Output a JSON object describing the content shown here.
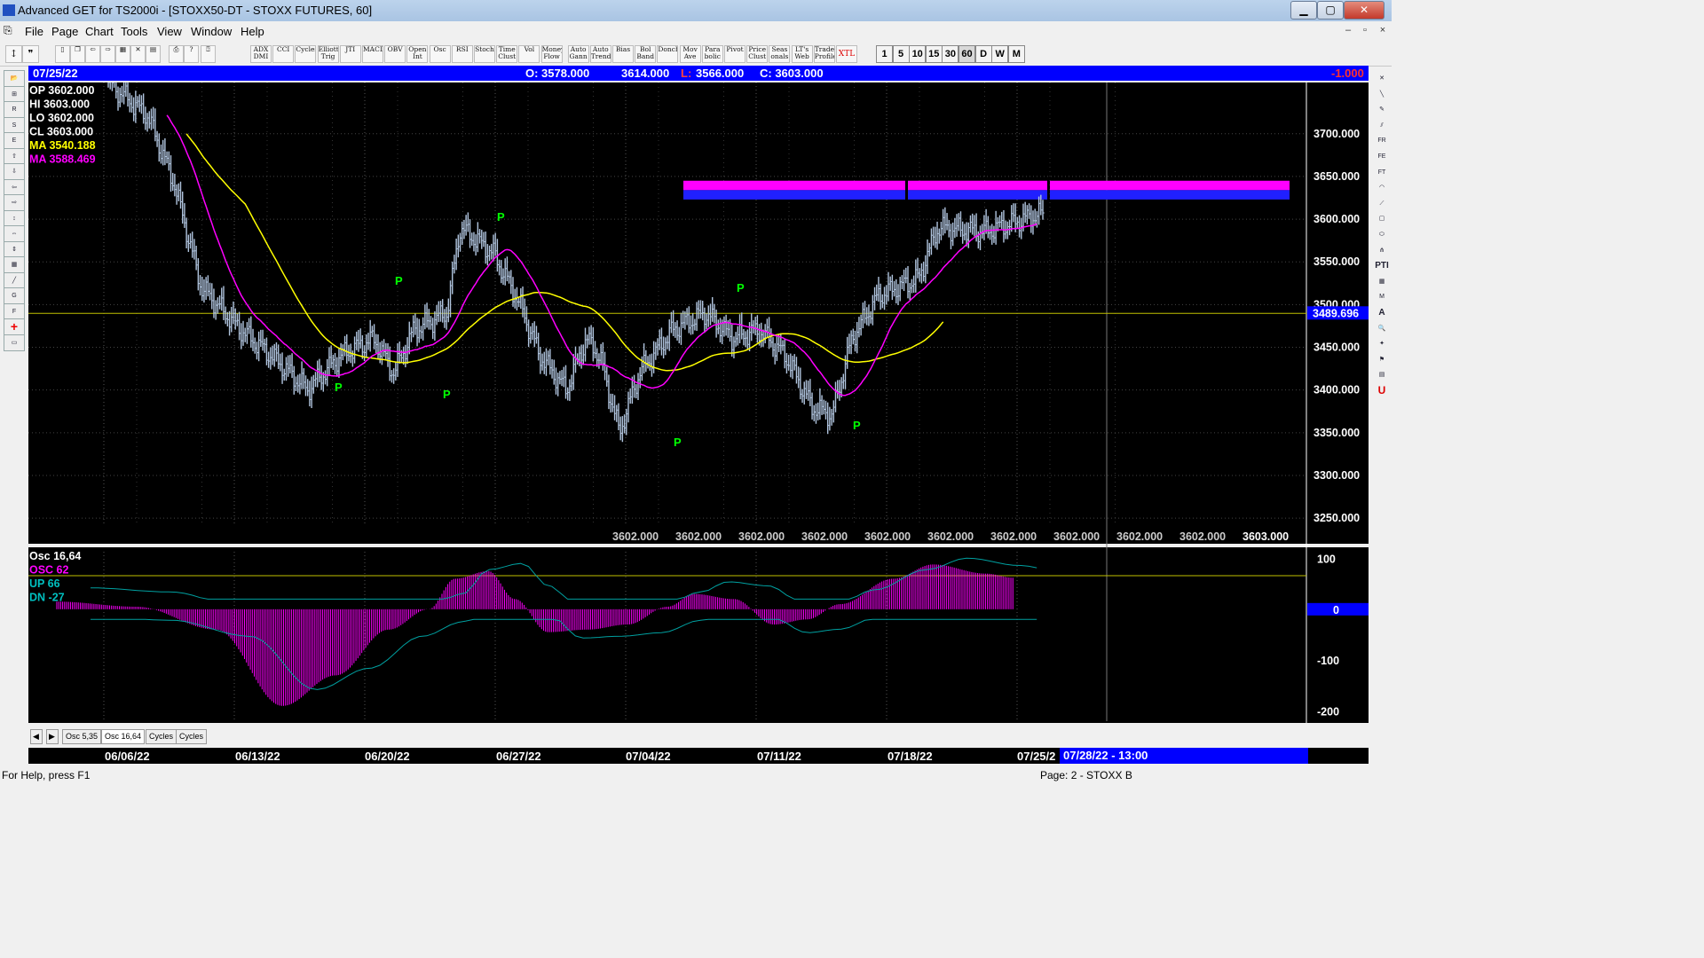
{
  "window": {
    "title": "Advanced GET for TS2000i - [STOXX50-DT - STOXX FUTURES, 60]",
    "min_label": "▁",
    "max_label": "▢",
    "close_label": "✕"
  },
  "menu": [
    "File",
    "Page",
    "Chart",
    "Tools",
    "View",
    "Window",
    "Help"
  ],
  "toolbar_studies": [
    {
      "id": "adx",
      "label": "ADX DMI"
    },
    {
      "id": "cci",
      "label": "CCI"
    },
    {
      "id": "cycles",
      "label": "Cycles"
    },
    {
      "id": "elliott",
      "label": "Elliott Trig"
    },
    {
      "id": "jti",
      "label": "JTI"
    },
    {
      "id": "macd",
      "label": "MACD"
    },
    {
      "id": "obv",
      "label": "OBV"
    },
    {
      "id": "openint",
      "label": "Open Int"
    },
    {
      "id": "osc",
      "label": "Osc"
    },
    {
      "id": "rsi",
      "label": "RSI"
    },
    {
      "id": "stoch",
      "label": "Stoch"
    },
    {
      "id": "timeclust",
      "label": "Time Clust"
    },
    {
      "id": "vol",
      "label": "Vol"
    },
    {
      "id": "moneyflow",
      "label": "Money Flow"
    },
    {
      "id": "autogann",
      "label": "Auto Gann"
    },
    {
      "id": "autotrend",
      "label": "Auto Trend"
    },
    {
      "id": "bias",
      "label": "Bias"
    },
    {
      "id": "bolband",
      "label": "Bol Band"
    },
    {
      "id": "donch",
      "label": "Donch"
    },
    {
      "id": "movave",
      "label": "Mov Ave"
    },
    {
      "id": "parabolic",
      "label": "Para bolic"
    },
    {
      "id": "pivot",
      "label": "Pivot"
    },
    {
      "id": "priceclust",
      "label": "Price Clust"
    },
    {
      "id": "seasonals",
      "label": "Seas onals"
    },
    {
      "id": "ltweb",
      "label": "LT's Web"
    },
    {
      "id": "tradeprofile",
      "label": "Trade Profile"
    },
    {
      "id": "xtl",
      "label": "XTL"
    }
  ],
  "toolbar_intervals": [
    "1",
    "5",
    "10",
    "15",
    "30",
    "60",
    "D",
    "W",
    "M"
  ],
  "info": {
    "date": "07/25/22",
    "open": "O: 3578.000",
    "high": "3614.000",
    "low_label": "L:",
    "low": "3566.000",
    "close": "C: 3603.000",
    "change": "-1.000"
  },
  "legend": [
    {
      "label": "OP",
      "value": "3602.000",
      "color": "#ffffff"
    },
    {
      "label": "HI",
      "value": "3603.000",
      "color": "#ffffff"
    },
    {
      "label": "LO",
      "value": "3602.000",
      "color": "#ffffff"
    },
    {
      "label": "CL",
      "value": "3603.000",
      "color": "#ffffff"
    },
    {
      "label": "MA",
      "value": "3540.188",
      "color": "#ffff00"
    },
    {
      "label": "MA",
      "value": "3588.469",
      "color": "#ff00ff"
    }
  ],
  "osc_legend": [
    {
      "label": "Osc 16,64",
      "color": "#ffffff"
    },
    {
      "label": "OSC 62",
      "color": "#ff00ff"
    },
    {
      "label": "UP   66",
      "color": "#00c0c0"
    },
    {
      "label": "DN   -27",
      "color": "#00c0c0"
    }
  ],
  "price_axis": [
    "3700.000",
    "3650.000",
    "3600.000",
    "3550.000",
    "3500.000",
    "3450.000",
    "3400.000",
    "3350.000",
    "3300.000",
    "3250.000"
  ],
  "price_axis_highlight": "3489.696",
  "bottom_price_labels": [
    "3602.000",
    "3602.000",
    "3602.000",
    "3602.000",
    "3602.000",
    "3602.000",
    "3602.000",
    "3602.000",
    "3602.000",
    "3602.000",
    "3603.000"
  ],
  "osc_axis": [
    "100",
    "0",
    "-100",
    "-200"
  ],
  "pivot_label": "P",
  "tabs": [
    "Osc 5,35",
    "Osc 16,64",
    "Cycles",
    "Cycles"
  ],
  "dates": [
    "06/06/22",
    "06/13/22",
    "06/20/22",
    "06/27/22",
    "07/04/22",
    "07/11/22",
    "07/18/22",
    "07/25/2"
  ],
  "date_cursor": "07/28/22 - 13:00",
  "status": {
    "help": "For Help, press F1",
    "page": "Page: 2 - STOXX B"
  },
  "colors": {
    "price_bars": "#b0c4de",
    "ma_fast": "#ffff00",
    "ma_slow": "#ff00ff",
    "osc": "#ff00ff",
    "up_dn": "#00a0a0",
    "zone_magenta": "#ff00ff",
    "zone_blue": "#2020ff",
    "pivot": "#00ff00"
  },
  "chart_data": {
    "type": "line",
    "title": "STOXX50-DT - STOXX FUTURES, 60",
    "ylim": [
      3220,
      3760
    ],
    "x": [
      "06/06/22",
      "06/13/22",
      "06/20/22",
      "06/27/22",
      "07/04/22",
      "07/11/22",
      "07/18/22",
      "07/25/22"
    ],
    "series": [
      {
        "name": "Close",
        "values": [
          3740,
          3490,
          3420,
          3560,
          3380,
          3470,
          3420,
          3610
        ]
      },
      {
        "name": "MA 3540.188",
        "values": [
          3750,
          3500,
          3450,
          3495,
          3450,
          3470,
          3500,
          3545
        ]
      },
      {
        "name": "MA 3588.469",
        "values": [
          3760,
          3480,
          3440,
          3520,
          3440,
          3460,
          3450,
          3590
        ]
      }
    ],
    "pivots": [
      {
        "date": "06/13/22",
        "type": "low",
        "value": 3400
      },
      {
        "date": "06/20/22",
        "type": "high",
        "value": 3510
      },
      {
        "date": "06/20/22",
        "type": "low",
        "value": 3400
      },
      {
        "date": "06/27/22",
        "type": "high",
        "value": 3590
      },
      {
        "date": "07/04/22",
        "type": "low",
        "value": 3345
      },
      {
        "date": "07/11/22",
        "type": "high",
        "value": 3505
      },
      {
        "date": "07/18/22",
        "type": "low",
        "value": 3360
      }
    ],
    "target_zone": [
      3623,
      3645
    ],
    "horizontal_line": 3489.696,
    "oscillator": {
      "name": "Osc 16,64",
      "ylim": [
        -220,
        120
      ],
      "up": 66,
      "dn": -27,
      "last": 62
    }
  }
}
